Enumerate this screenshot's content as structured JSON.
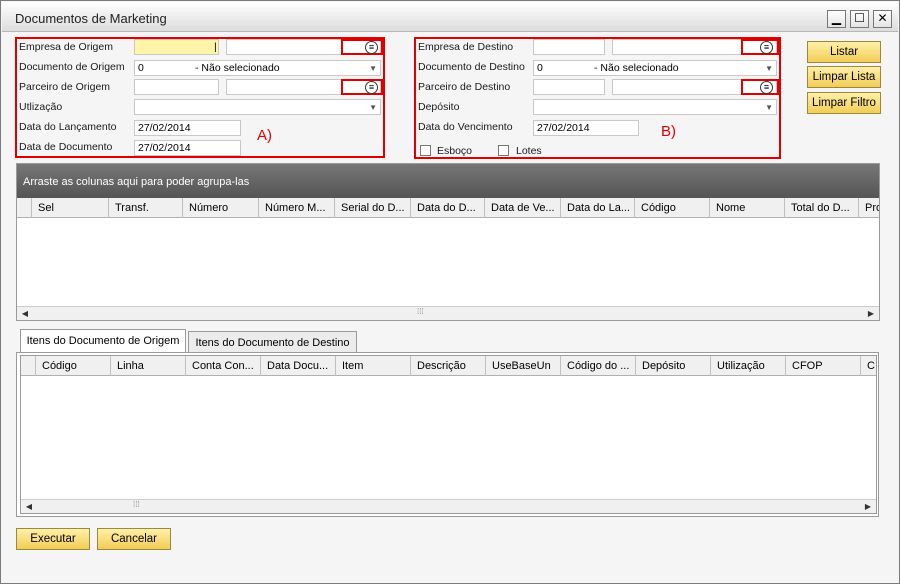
{
  "window": {
    "title": "Documentos de Marketing"
  },
  "controls": {
    "minimize": "▁",
    "maximize": "☐",
    "close": "✕"
  },
  "section_a": {
    "marker": "A)",
    "empresa_origem": {
      "label": "Empresa de Origem",
      "value": "|"
    },
    "documento_origem": {
      "label": "Documento de Origem",
      "value": "0",
      "selected": "- Não selecionado"
    },
    "parceiro_origem": {
      "label": "Parceiro de Origem"
    },
    "utilizacao": {
      "label": "Utlização"
    },
    "data_lancamento": {
      "label": "Data do Lançamento",
      "value": "27/02/2014"
    },
    "data_documento": {
      "label": "Data de Documento",
      "value": "27/02/2014"
    }
  },
  "section_b": {
    "marker": "B)",
    "empresa_destino": {
      "label": "Empresa de Destino"
    },
    "documento_destino": {
      "label": "Documento de Destino",
      "value": "0",
      "selected": "- Não selecionado"
    },
    "parceiro_destino": {
      "label": "Parceiro de Destino"
    },
    "deposito": {
      "label": "Depósito"
    },
    "data_vencimento": {
      "label": "Data do Vencimento",
      "value": "27/02/2014"
    },
    "esboco": {
      "label": "Esboço",
      "checked": false
    },
    "lotes": {
      "label": "Lotes",
      "checked": false
    }
  },
  "side_buttons": {
    "listar": "Listar",
    "limpar_lista": "Limpar Lista",
    "limpar_filtro": "Limpar Filtro"
  },
  "grid1": {
    "group_hint": "Arraste as colunas aqui para poder agrupa-las",
    "columns": [
      "Sel",
      "Transf.",
      "Número",
      "Número M...",
      "Serial do D...",
      "Data do D...",
      "Data de Ve...",
      "Data do La...",
      "Código",
      "Nome",
      "Total do D...",
      "Pro"
    ]
  },
  "tabs": {
    "origem": "Itens do Documento de Origem",
    "destino": "Itens do Documento de Destino"
  },
  "grid2": {
    "columns": [
      "Código",
      "Linha",
      "Conta Con...",
      "Data Docu...",
      "Item",
      "Descrição",
      "UseBaseUn",
      "Código do ...",
      "Depósito",
      "Utilização",
      "CFOP",
      "C:"
    ]
  },
  "footer": {
    "executar": "Executar",
    "cancelar": "Cancelar"
  }
}
